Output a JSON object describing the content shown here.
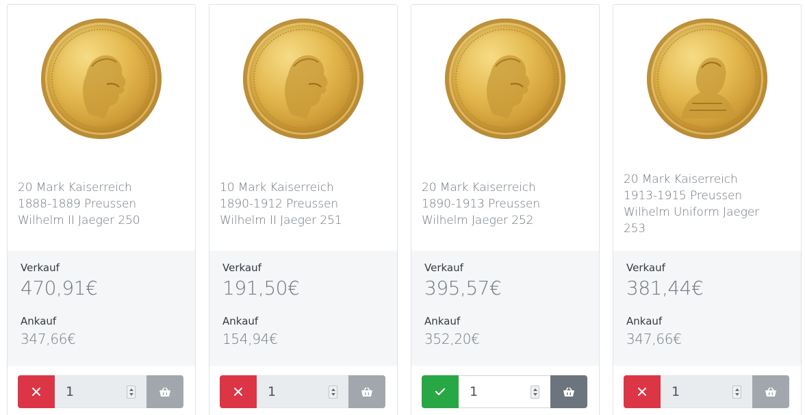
{
  "products": [
    {
      "title_lines": [
        "20 Mark Kaiserreich",
        "1888-1889 Preussen",
        "Wilhelm II Jaeger 250"
      ],
      "sell_label": "Verkauf",
      "sell_price": "470,91€",
      "buy_label": "Ankauf",
      "buy_price": "347,66€",
      "quantity": "1",
      "status": "unavailable",
      "status_icon": "close-icon",
      "cart_icon": "basket-icon"
    },
    {
      "title_lines": [
        "10 Mark Kaiserreich",
        "1890-1912 Preussen",
        "Wilhelm II Jaeger 251"
      ],
      "sell_label": "Verkauf",
      "sell_price": "191,50€",
      "buy_label": "Ankauf",
      "buy_price": "154,94€",
      "quantity": "1",
      "status": "unavailable",
      "status_icon": "close-icon",
      "cart_icon": "basket-icon"
    },
    {
      "title_lines": [
        "20 Mark Kaiserreich",
        "1890-1913 Preussen",
        "Wilhelm Jaeger 252"
      ],
      "sell_label": "Verkauf",
      "sell_price": "395,57€",
      "buy_label": "Ankauf",
      "buy_price": "352,20€",
      "quantity": "1",
      "status": "available",
      "status_icon": "check-icon",
      "cart_icon": "basket-icon"
    },
    {
      "title_lines": [
        "20 Mark Kaiserreich",
        "1913-1915 Preussen",
        "Wilhelm Uniform Jaeger",
        "253"
      ],
      "sell_label": "Verkauf",
      "sell_price": "381,44€",
      "buy_label": "Ankauf",
      "buy_price": "347,66€",
      "quantity": "1",
      "status": "unavailable",
      "status_icon": "close-icon",
      "cart_icon": "basket-icon"
    }
  ],
  "colors": {
    "unavailable": "#dc3545",
    "available": "#28a745",
    "cart_disabled": "#a1a7ad",
    "cart_enabled": "#6c757d",
    "price_panel": "#f5f6f8"
  }
}
